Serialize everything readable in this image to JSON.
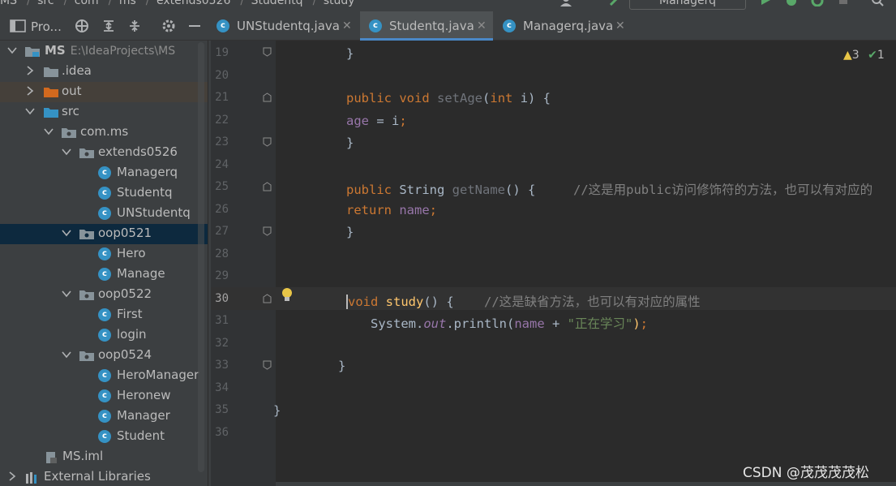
{
  "breadcrumb": {
    "items": [
      "MS",
      "src",
      "com",
      "ms",
      "extends0526",
      "Studentq",
      "study"
    ],
    "run_config": "Managerq"
  },
  "project_panel": {
    "title": "Pro..."
  },
  "tabs": [
    {
      "label": "UNStudentq.java",
      "active": false
    },
    {
      "label": "Studentq.java",
      "active": true
    },
    {
      "label": "Managerq.java",
      "active": false
    }
  ],
  "tree": {
    "root": {
      "label": "MS",
      "path": "E:\\IdeaProjects\\MS"
    },
    "idea": ".idea",
    "out": "out",
    "src": "src",
    "com_ms": "com.ms",
    "extends0526": "extends0526",
    "extends_children": [
      "Managerq",
      "Studentq",
      "UNStudentq"
    ],
    "oop0521": "oop0521",
    "oop0521_children": [
      "Hero",
      "Manage"
    ],
    "oop0522": "oop0522",
    "oop0522_children": [
      "First",
      "login"
    ],
    "oop0524": "oop0524",
    "oop0524_children": [
      "HeroManager",
      "Heronew",
      "Manager",
      "Student"
    ],
    "iml": "MS.iml",
    "external": "External Libraries"
  },
  "editor": {
    "line_numbers": [
      "19",
      "20",
      "21",
      "22",
      "23",
      "24",
      "25",
      "26",
      "27",
      "28",
      "29",
      "30",
      "31",
      "32",
      "33",
      "34",
      "35",
      "36"
    ],
    "current_line": "30",
    "lines": {
      "l19_brace": "}",
      "l21_public": "public",
      "l21_void": "void",
      "l21_name": "setAge",
      "l21_open": "(",
      "l21_int": "int",
      "l21_rest": " i) {",
      "l22_field": "age",
      "l22_rest": " = i",
      "l22_semi": ";",
      "l23_brace": "}",
      "l25_public": "public",
      "l25_type": " String ",
      "l25_name": "getName",
      "l25_rest": "() {",
      "l25_comment": "//这是用public访问修饰符的方法，也可以有对应的",
      "l26_return": "return",
      "l26_field": "name",
      "l26_semi": ";",
      "l27_brace": "}",
      "l30_void": "void",
      "l30_name": "study",
      "l30_rest": "() {",
      "l30_comment": "//这是缺省方法，也可以有对应的属性",
      "l31_sys": "System.",
      "l31_out": "out",
      "l31_println": ".println(",
      "l31_name": "name",
      "l31_plus": " + ",
      "l31_str": "\"正在学习\"",
      "l31_close": ")",
      "l31_semi": ";",
      "l33_brace": "}",
      "l35_brace": "}"
    }
  },
  "inspections": {
    "warnings": "3",
    "ok": "1"
  },
  "watermark": "CSDN @茂茂茂茂松",
  "colors": {
    "keyword": "#cc7832",
    "function": "#ffc66d",
    "field": "#9876aa",
    "string": "#6a8759",
    "comment": "#808080",
    "selection": "#0d293e",
    "accent": "#4a88c7"
  }
}
